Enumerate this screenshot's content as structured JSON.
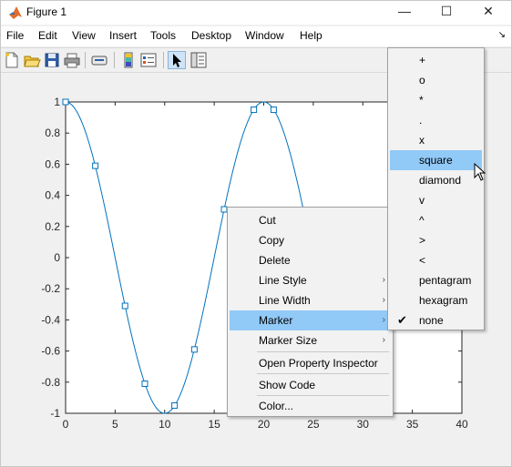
{
  "window": {
    "title": "Figure 1",
    "icon": "matlab-logo-icon",
    "controls": [
      "minimize-icon",
      "maximize-icon",
      "close-icon"
    ]
  },
  "menubar": {
    "items": [
      "File",
      "Edit",
      "View",
      "Insert",
      "Tools",
      "Desktop",
      "Window",
      "Help"
    ],
    "dock_icon": "dock-arrow-icon"
  },
  "toolbar": {
    "buttons": [
      {
        "icon": "new-figure-icon"
      },
      {
        "icon": "open-file-icon"
      },
      {
        "icon": "save-icon"
      },
      {
        "icon": "print-icon"
      },
      {
        "icon": "link-plot-icon"
      },
      {
        "icon": "insert-colorbar-icon"
      },
      {
        "icon": "insert-legend-icon"
      },
      {
        "icon": "edit-plot-icon",
        "active": true
      },
      {
        "icon": "property-inspector-icon"
      }
    ]
  },
  "chart_data": {
    "type": "line",
    "title": "",
    "xlabel": "",
    "ylabel": "",
    "xlim": [
      0,
      40
    ],
    "ylim": [
      -1,
      1
    ],
    "xticks": [
      0,
      5,
      10,
      15,
      20,
      25,
      30,
      35,
      40
    ],
    "yticks": [
      -1,
      -0.8,
      -0.6,
      -0.4,
      -0.2,
      0,
      0.2,
      0.4,
      0.6,
      0.8,
      1
    ],
    "ytick_labels": [
      "-1",
      "-0.8",
      "-0.6",
      "-0.4",
      "-0.2",
      "0",
      "0.2",
      "0.4",
      "0.6",
      "0.8",
      "1"
    ],
    "series_color": "#0072bd",
    "marker": "square",
    "visible_markers_x": [
      0,
      3,
      6,
      8,
      11,
      13,
      16,
      19,
      21
    ],
    "x": [
      0,
      1,
      2,
      3,
      4,
      5,
      6,
      7,
      8,
      9,
      10,
      11,
      12,
      13,
      14,
      15,
      16,
      17,
      18,
      19,
      20,
      21,
      22,
      23,
      24,
      25,
      26
    ],
    "y": [
      1.0,
      0.95,
      0.81,
      0.59,
      0.31,
      0.0,
      -0.31,
      -0.59,
      -0.81,
      -0.95,
      -1.0,
      -0.95,
      -0.81,
      -0.59,
      -0.31,
      0.0,
      0.31,
      0.59,
      0.81,
      0.95,
      1.0,
      0.95,
      0.81,
      0.59,
      0.31,
      0.0,
      -0.31
    ],
    "grid": false
  },
  "context_menu": {
    "items": [
      {
        "label": "Cut",
        "submenu": false
      },
      {
        "label": "Copy",
        "submenu": false
      },
      {
        "label": "Delete",
        "submenu": false
      },
      {
        "label": "Line Style",
        "submenu": true
      },
      {
        "label": "Line Width",
        "submenu": true
      },
      {
        "label": "Marker",
        "submenu": true,
        "highlighted": true
      },
      {
        "label": "Marker Size",
        "submenu": true
      },
      {
        "label": "Open Property Inspector",
        "submenu": false
      },
      {
        "label": "Show Code",
        "submenu": false
      },
      {
        "label": "Color...",
        "submenu": false
      }
    ],
    "submenu_arrow": "›"
  },
  "marker_submenu": {
    "items": [
      {
        "label": "+"
      },
      {
        "label": "o"
      },
      {
        "label": "*"
      },
      {
        "label": "."
      },
      {
        "label": "x"
      },
      {
        "label": "square",
        "highlighted": true
      },
      {
        "label": "diamond"
      },
      {
        "label": "v"
      },
      {
        "label": "^"
      },
      {
        "label": ">"
      },
      {
        "label": "<"
      },
      {
        "label": "pentagram"
      },
      {
        "label": "hexagram"
      },
      {
        "label": "none",
        "checked": true
      }
    ],
    "check_glyph": "✔"
  }
}
